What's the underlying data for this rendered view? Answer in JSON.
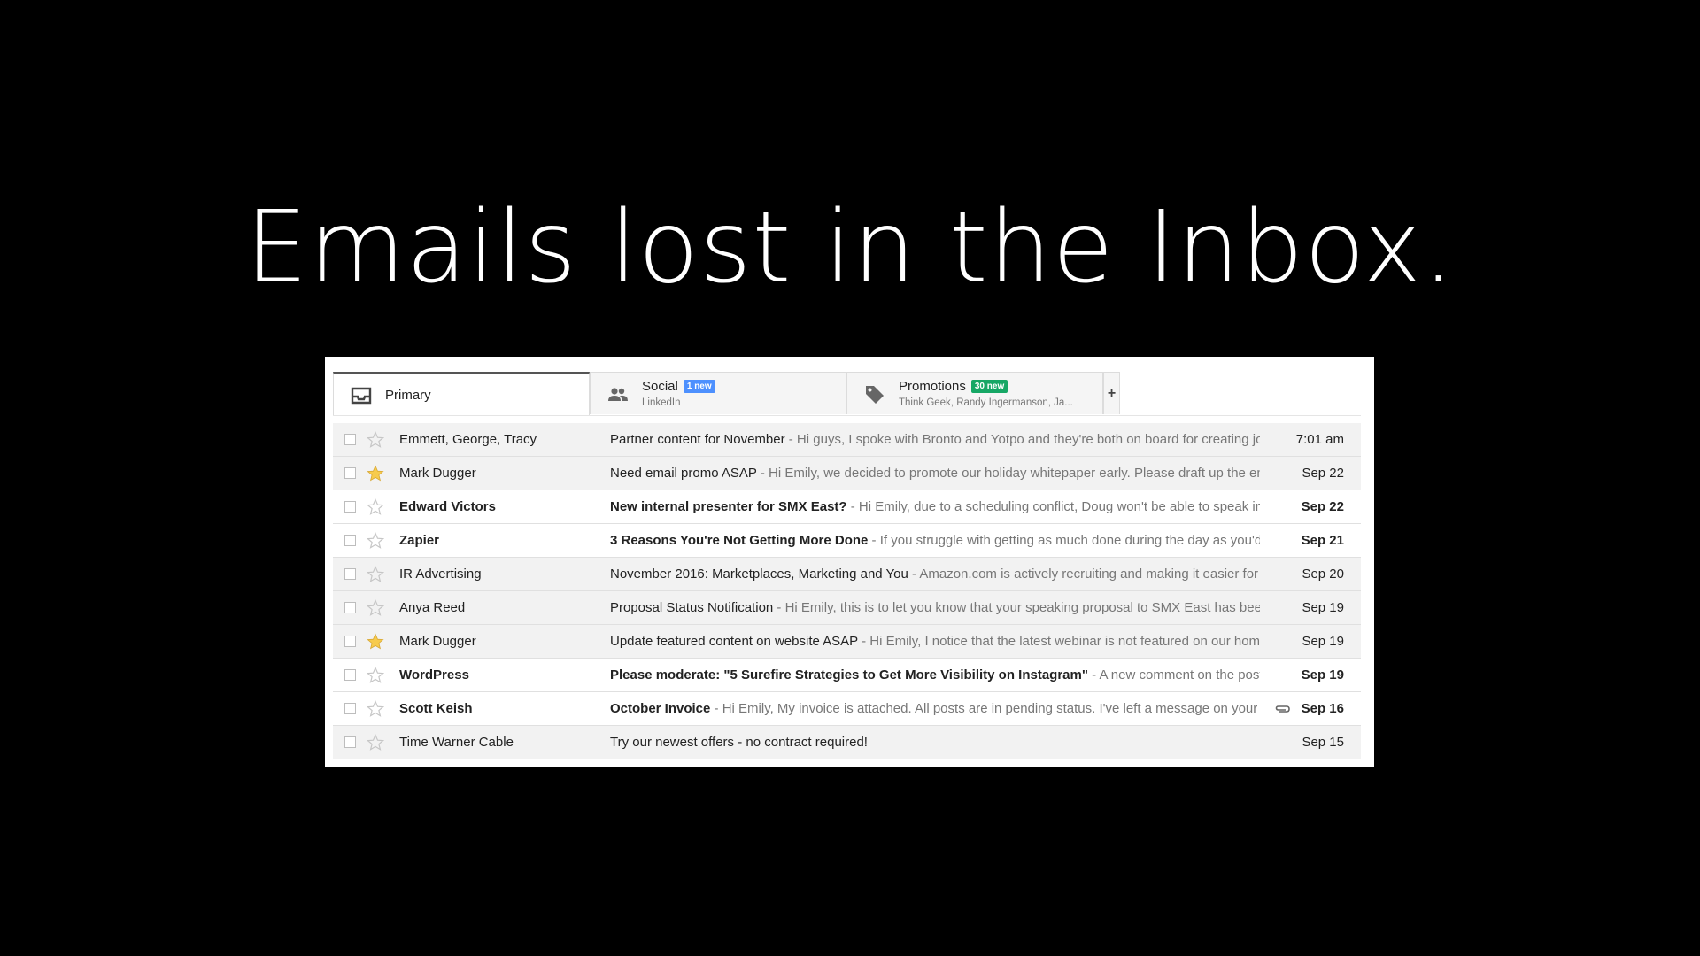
{
  "slide": {
    "title": "Emails lost in the Inbox."
  },
  "tabs": {
    "primary": {
      "label": "Primary",
      "icon": "inbox-icon"
    },
    "social": {
      "label": "Social",
      "badge": "1 new",
      "badge_color": "#4d90fe",
      "subtitle": "LinkedIn",
      "icon": "people-icon"
    },
    "promotions": {
      "label": "Promotions",
      "badge": "30 new",
      "badge_color": "#16a765",
      "subtitle": "Think Geek, Randy Ingermanson, Ja...",
      "icon": "tag-icon"
    },
    "add_label": "+"
  },
  "star_color": "#f7cb4d",
  "emails": [
    {
      "sender": "Emmett, George, Tracy",
      "subject": "Partner content for November",
      "snippet": " - Hi guys, I spoke with Bronto and Yotpo and they're both on board for creating join",
      "date": "7:01 am",
      "unread": false,
      "starred": false,
      "attachment": false
    },
    {
      "sender": "Mark Dugger",
      "subject": "Need email promo ASAP",
      "snippet": " - Hi Emily, we decided to promote our holiday whitepaper early. Please draft up the em",
      "date": "Sep 22",
      "unread": false,
      "starred": true,
      "attachment": false
    },
    {
      "sender": "Edward Victors",
      "subject": "New internal presenter for SMX East?",
      "snippet": " - Hi Emily, due to a scheduling conflict, Doug won't be able to speak in",
      "date": "Sep 22",
      "unread": true,
      "starred": false,
      "attachment": false
    },
    {
      "sender": "Zapier",
      "subject": "3 Reasons You're Not Getting More Done",
      "snippet": " - If you struggle with getting as much done during the day as you'd l",
      "date": "Sep 21",
      "unread": true,
      "starred": false,
      "attachment": false
    },
    {
      "sender": "IR Advertising",
      "subject": "November 2016: Marketplaces, Marketing and You",
      "snippet": " - Amazon.com is actively recruiting and making it easier for o",
      "date": "Sep 20",
      "unread": false,
      "starred": false,
      "attachment": false
    },
    {
      "sender": "Anya Reed",
      "subject": "Proposal Status Notification",
      "snippet": " - Hi Emily, this is to let you know that your speaking proposal to SMX East has been",
      "date": "Sep 19",
      "unread": false,
      "starred": false,
      "attachment": false
    },
    {
      "sender": "Mark Dugger",
      "subject": "Update featured content on website ASAP",
      "snippet": " - Hi Emily, I notice that the latest webinar is not featured on our home",
      "date": "Sep 19",
      "unread": false,
      "starred": true,
      "attachment": false
    },
    {
      "sender": "WordPress",
      "subject": "Please moderate: \"5 Surefire Strategies to Get More Visibility on Instagram\"",
      "snippet": " - A new comment on the post",
      "date": "Sep 19",
      "unread": true,
      "starred": false,
      "attachment": false
    },
    {
      "sender": "Scott Keish",
      "subject": "October Invoice",
      "snippet": " - Hi Emily,  My invoice is attached. All posts are in pending status. I've left a message on your",
      "date": "Sep 16",
      "unread": true,
      "starred": false,
      "attachment": true
    },
    {
      "sender": "Time Warner Cable",
      "subject": "Try our newest offers - no contract required!",
      "snippet": "",
      "date": "Sep 15",
      "unread": false,
      "starred": false,
      "attachment": false
    }
  ]
}
